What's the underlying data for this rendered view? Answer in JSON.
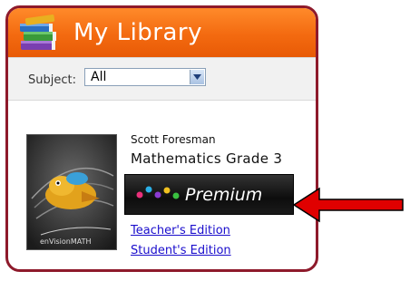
{
  "header": {
    "title": "My Library",
    "icon": "books-icon",
    "color": "#f36a10",
    "border_color": "#8e1a2b"
  },
  "filter": {
    "subject_label": "Subject:",
    "subject_value": "All"
  },
  "book": {
    "publisher": "Scott Foresman",
    "title": "Mathematics Grade 3",
    "badge": "Premium",
    "cover_logo": "enVisionMATH",
    "links": [
      "Teacher's Edition",
      "Student's Edition"
    ]
  },
  "annotation": {
    "arrow_color": "#e00000"
  }
}
